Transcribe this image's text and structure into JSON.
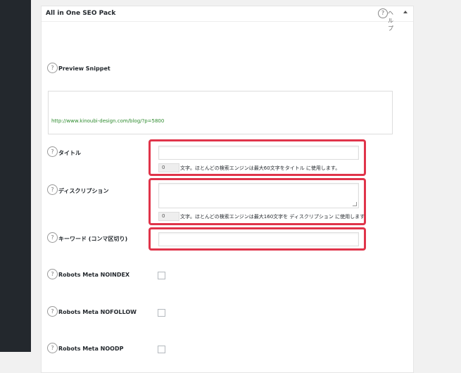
{
  "panel": {
    "title": "All in One SEO Pack",
    "help_label": "ヘルプ"
  },
  "rows": {
    "preview_snippet": {
      "label": "Preview Snippet",
      "url": "http://www.kinoubi-design.com/blog/?p=5800"
    },
    "title": {
      "label": "タイトル",
      "count": "0",
      "note": "文字。ほとんどの検索エンジンは最大60文字をタイトル に使用します。"
    },
    "description": {
      "label": "ディスクリプション",
      "count": "0",
      "note": "文字。ほとんどの検索エンジンは最大160文字を ディスクリプション に使用します"
    },
    "keywords": {
      "label": "キーワード (コンマ区切り)"
    },
    "noindex": {
      "label": "Robots Meta NOINDEX"
    },
    "nofollow": {
      "label": "Robots Meta NOFOLLOW"
    },
    "noodp": {
      "label": "Robots Meta NOODP"
    }
  },
  "help_icon_glyph": "?",
  "colors": {
    "highlight": "#e0344a",
    "url_green": "#2e8b2e",
    "sidebar": "#23282d"
  }
}
